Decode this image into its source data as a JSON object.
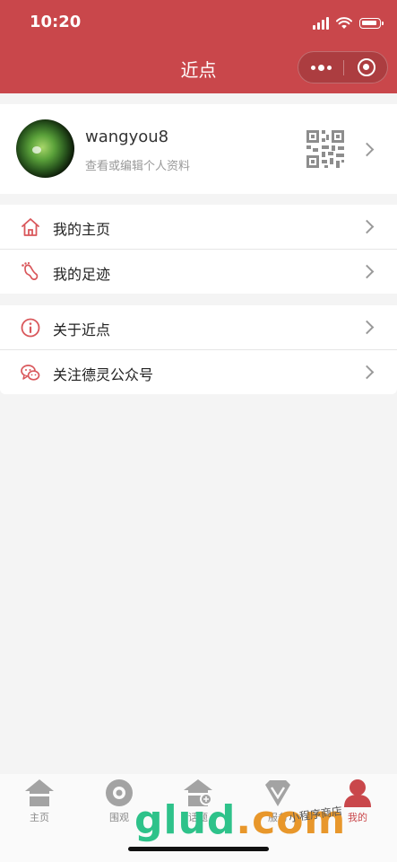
{
  "status_bar": {
    "time": "10:20"
  },
  "nav": {
    "title": "近点"
  },
  "profile": {
    "username": "wangyou8",
    "subtitle": "查看或编辑个人资料"
  },
  "menu": {
    "group1": [
      {
        "label": "我的主页",
        "icon": "home-icon"
      },
      {
        "label": "我的足迹",
        "icon": "footprint-icon"
      }
    ],
    "group2": [
      {
        "label": "关于近点",
        "icon": "info-icon"
      },
      {
        "label": "关注德灵公众号",
        "icon": "wechat-icon"
      }
    ]
  },
  "tabbar": [
    {
      "label": "主页",
      "icon": "home-tab-icon",
      "active": false
    },
    {
      "label": "围观",
      "icon": "eye-tab-icon",
      "active": false
    },
    {
      "label": "话题",
      "icon": "topic-tab-icon",
      "active": false
    },
    {
      "label": "服务",
      "icon": "service-tab-icon",
      "active": false
    },
    {
      "label": "我的",
      "icon": "user-tab-icon",
      "active": true
    }
  ],
  "watermark": {
    "main_a": "glud",
    "main_b": ".com",
    "sub": "小程序商店"
  },
  "colors": {
    "brand": "#c9474b",
    "icon_accent": "#d9575b",
    "tab_inactive": "#9a9a9a"
  }
}
